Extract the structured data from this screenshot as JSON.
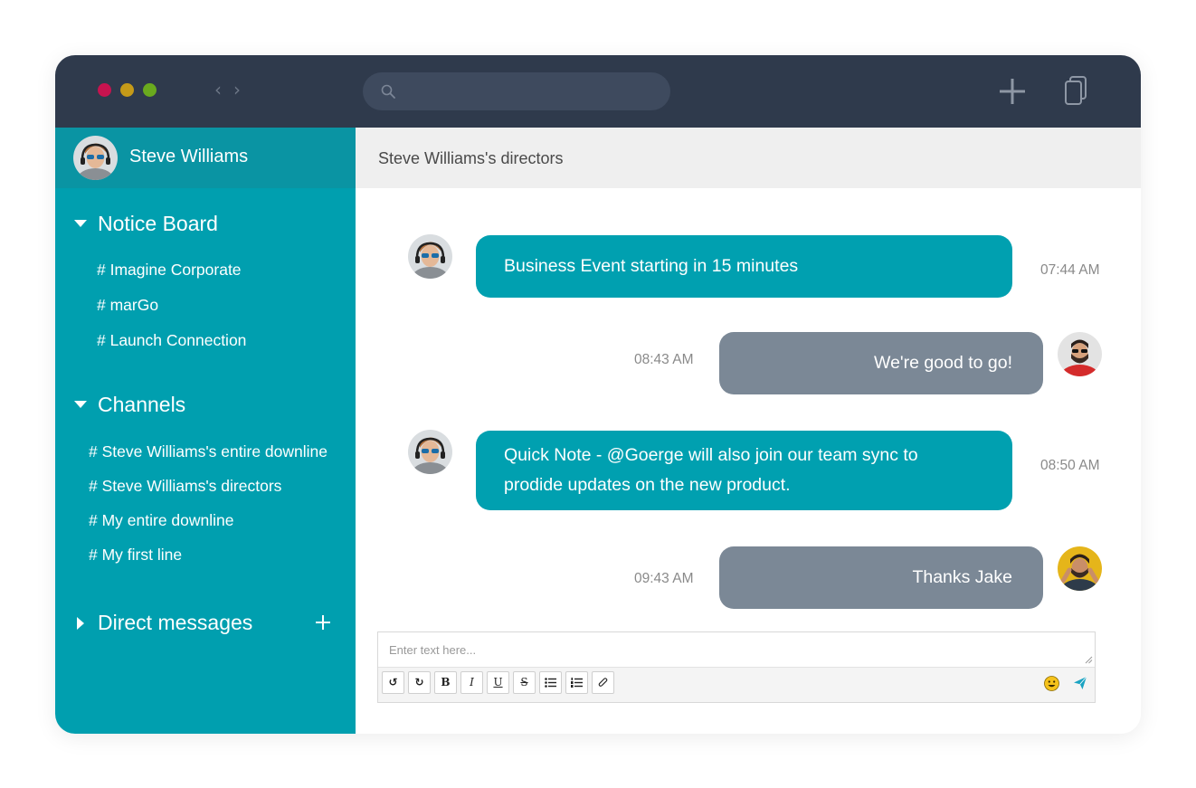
{
  "colors": {
    "titlebar": "#2f3a4c",
    "sidebar": "#009faf",
    "teal_bubble": "#00a0b0",
    "gray_bubble": "#7b8896",
    "dot_red": "#c7134f",
    "dot_yellow": "#c59a18",
    "dot_green": "#6aaa1e"
  },
  "titlebar": {
    "back_icon": "chevron-left-icon",
    "forward_icon": "chevron-right-icon",
    "search_icon": "search-icon",
    "search_placeholder": "",
    "new_icon": "plus-icon",
    "copy_icon": "copy-icon"
  },
  "sidebar": {
    "user_name": "Steve Williams",
    "notice_board": {
      "title": "Notice Board",
      "items": [
        "# Imagine Corporate",
        "# marGo",
        "# Launch Connection"
      ]
    },
    "channels": {
      "title": "Channels",
      "items": [
        "# Steve Williams's entire downline",
        "# Steve Williams's directors",
        "# My entire downline",
        "# My first line"
      ]
    },
    "direct_messages": {
      "title": "Direct messages"
    }
  },
  "main": {
    "title": "Steve Williams's directors",
    "messages": [
      {
        "text": "Business Event starting in 15 minutes",
        "time": "07:44 AM"
      },
      {
        "text": "We're good to go!",
        "time": "08:43 AM"
      },
      {
        "text": "Quick Note - @Goerge will also  join our team sync to prodide updates on the new product.",
        "time": "08:50 AM"
      },
      {
        "text": "Thanks Jake",
        "time": "09:43 AM"
      }
    ],
    "composer": {
      "placeholder": "Enter text here...",
      "toolbar": {
        "undo": "↺",
        "redo": "↻",
        "bold": "B",
        "italic": "I",
        "underline": "U",
        "strike": "S"
      }
    }
  }
}
